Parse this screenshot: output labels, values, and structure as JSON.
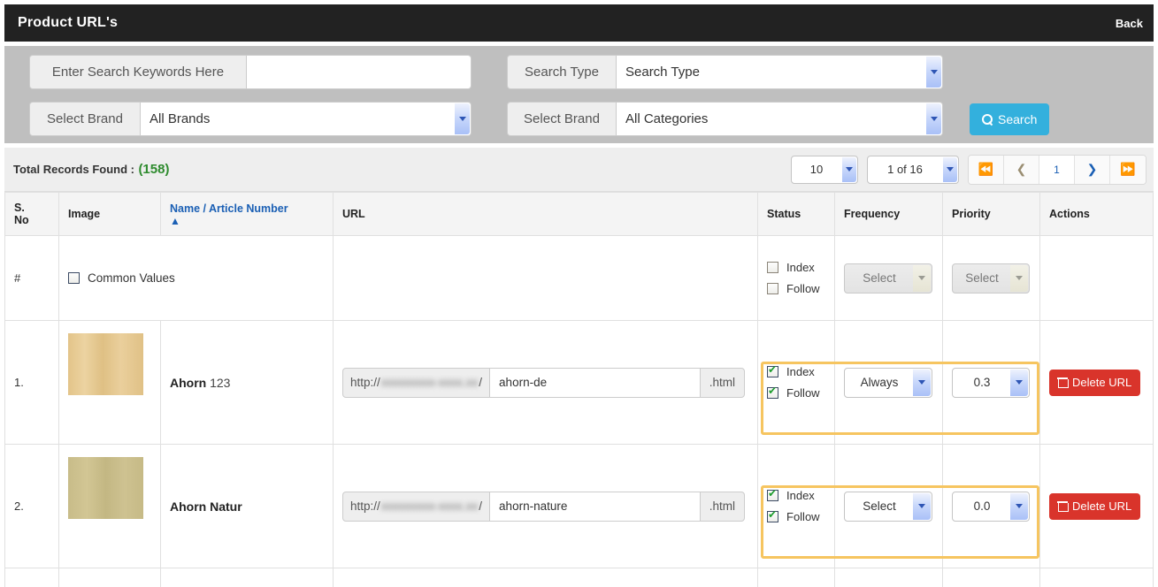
{
  "header": {
    "title": "Product URL's",
    "back_label": "Back"
  },
  "filters": {
    "keywords_label": "Enter Search Keywords Here",
    "keywords_value": "",
    "keywords_placeholder": "",
    "search_type_label": "Search Type",
    "search_type_value": "Search Type",
    "brand_label": "Select Brand",
    "brand_value": "All Brands",
    "category_label": "Select Brand",
    "category_value": "All Categories",
    "search_button": "Search"
  },
  "records": {
    "total_label": "Total Records Found :",
    "total_count": "(158)",
    "page_size": "10",
    "page_of": "1 of 16",
    "current_page": "1",
    "first_icon": "double-chevron-left-icon",
    "prev_icon": "chevron-left-icon",
    "next_icon": "chevron-right-icon",
    "last_icon": "double-chevron-right-icon"
  },
  "table": {
    "columns": [
      {
        "key": "sno",
        "label": "S. No",
        "line1": "S.",
        "line2": "No"
      },
      {
        "key": "img",
        "label": "Image"
      },
      {
        "key": "name",
        "label": "Name / Article Number",
        "sorted": "asc"
      },
      {
        "key": "url",
        "label": "URL"
      },
      {
        "key": "stat",
        "label": "Status"
      },
      {
        "key": "freq",
        "label": "Frequency"
      },
      {
        "key": "prio",
        "label": "Priority"
      },
      {
        "key": "act",
        "label": "Actions"
      }
    ],
    "common_row": {
      "sno": "#",
      "checkbox_label": "Common Values",
      "checkbox_checked": false,
      "index_label": "Index",
      "index_checked": false,
      "follow_label": "Follow",
      "follow_checked": false,
      "frequency": "Select",
      "priority": "Select",
      "highlighted": false
    },
    "rows": [
      {
        "sno": "1.",
        "swatch_color": "#e4c98b",
        "name": "Ahorn",
        "article_number": "123",
        "url_prefix": "http://",
        "url_domain_redacted": "xxxxxxxxx-xxxx.xx",
        "url_prefix_slash": "/",
        "url_slug": "ahorn-de",
        "url_suffix": ".html",
        "index_label": "Index",
        "index_checked": true,
        "follow_label": "Follow",
        "follow_checked": true,
        "frequency": "Always",
        "priority": "0.3",
        "delete_label": "Delete URL",
        "highlighted": true
      },
      {
        "sno": "2.",
        "swatch_color": "#c9bd8a",
        "name": "Ahorn Natur",
        "article_number": "",
        "url_prefix": "http://",
        "url_domain_redacted": "xxxxxxxxx-xxxx.xx",
        "url_prefix_slash": "/",
        "url_slug": "ahorn-nature",
        "url_suffix": ".html",
        "index_label": "Index",
        "index_checked": true,
        "follow_label": "Follow",
        "follow_checked": true,
        "frequency": "Select",
        "priority": "0.0",
        "delete_label": "Delete URL",
        "highlighted": true
      }
    ]
  },
  "colors": {
    "header_bg": "#222222",
    "filter_bg": "#bfbfbf",
    "accent_blue": "#33b0dd",
    "link_blue": "#1a5fb4",
    "count_green": "#2e8b2e",
    "danger_red": "#d9342b",
    "highlight_orange": "#f6c560"
  }
}
